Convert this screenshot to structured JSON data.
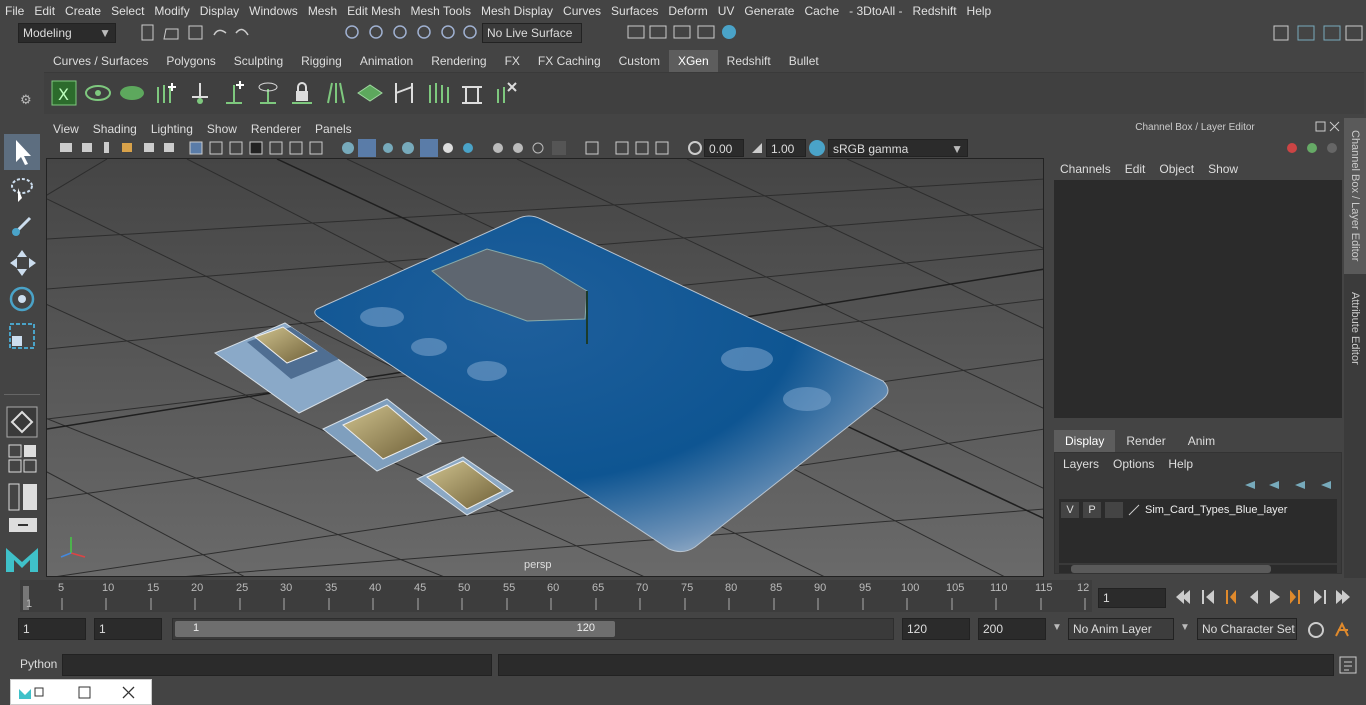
{
  "menus": [
    "File",
    "Edit",
    "Create",
    "Select",
    "Modify",
    "Display",
    "Windows",
    "Mesh",
    "Edit Mesh",
    "Mesh Tools",
    "Mesh Display",
    "Curves",
    "Surfaces",
    "Deform",
    "UV",
    "Generate",
    "Cache",
    "- 3DtoAll -",
    "Redshift",
    "Help"
  ],
  "status": {
    "mode": "Modeling",
    "live_surface": "No Live Surface"
  },
  "shelf_tabs": [
    {
      "label": "Curves / Surfaces",
      "active": false
    },
    {
      "label": "Polygons",
      "active": false
    },
    {
      "label": "Sculpting",
      "active": false
    },
    {
      "label": "Rigging",
      "active": false
    },
    {
      "label": "Animation",
      "active": false
    },
    {
      "label": "Rendering",
      "active": false
    },
    {
      "label": "FX",
      "active": false
    },
    {
      "label": "FX Caching",
      "active": false
    },
    {
      "label": "Custom",
      "active": false
    },
    {
      "label": "XGen",
      "active": true
    },
    {
      "label": "Redshift",
      "active": false
    },
    {
      "label": "Bullet",
      "active": false
    }
  ],
  "viewport": {
    "menus": [
      "View",
      "Shading",
      "Lighting",
      "Show",
      "Renderer",
      "Panels"
    ],
    "exposure": "0.00",
    "gamma": "1.00",
    "color_space": "sRGB gamma",
    "camera": "persp"
  },
  "right_panel": {
    "title": "Channel Box / Layer Editor",
    "menus": [
      "Channels",
      "Edit",
      "Object",
      "Show"
    ],
    "tabs": [
      {
        "label": "Display",
        "active": true
      },
      {
        "label": "Render",
        "active": false
      },
      {
        "label": "Anim",
        "active": false
      }
    ],
    "layer_menus": [
      "Layers",
      "Options",
      "Help"
    ],
    "layer": {
      "v": "V",
      "p": "P",
      "name": "Sim_Card_Types_Blue_layer"
    }
  },
  "side_tabs": [
    "Channel Box / Layer Editor",
    "Attribute Editor"
  ],
  "timeline": {
    "ticks": [
      "1",
      "5",
      "10",
      "15",
      "20",
      "25",
      "30",
      "35",
      "40",
      "45",
      "50",
      "55",
      "60",
      "65",
      "70",
      "75",
      "80",
      "85",
      "90",
      "95",
      "100",
      "105",
      "110",
      "115",
      "12"
    ],
    "current_frame": "1"
  },
  "range": {
    "start": "1",
    "anim_start": "1",
    "slider_start": "1",
    "slider_end": "120",
    "end": "120",
    "anim_end": "200",
    "anim_layer": "No Anim Layer",
    "character_set": "No Character Set"
  },
  "command": {
    "language": "Python"
  }
}
